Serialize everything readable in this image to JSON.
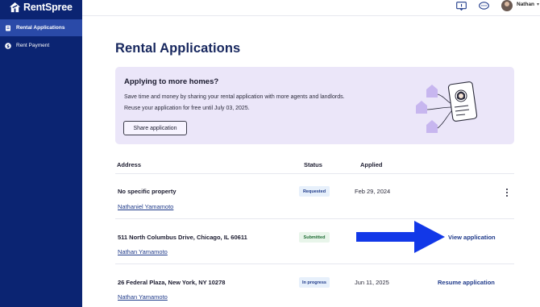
{
  "app": {
    "brand": "RentSpree",
    "brand_color": "#0b2472",
    "accent": "#1f3a8a"
  },
  "sidebar": {
    "items": [
      {
        "label": "Rental Applications",
        "icon": "document-icon",
        "active": true
      },
      {
        "label": "Rent Payment",
        "icon": "dollar-icon",
        "active": false
      }
    ]
  },
  "topbar": {
    "icons": [
      "help-chat-icon",
      "message-bubble-icon"
    ],
    "user_name": "Nathan"
  },
  "page": {
    "title": "Rental Applications"
  },
  "promo": {
    "title": "Applying to more homes?",
    "line1": "Save time and money by sharing your rental application with more agents and landlords.",
    "line2": "Reuse your application for free until July 03, 2025.",
    "button_label": "Share application",
    "illustration": "application-share-illustration"
  },
  "table": {
    "headers": {
      "address": "Address",
      "status": "Status",
      "applied": "Applied"
    },
    "rows": [
      {
        "address": "No specific property",
        "renter": "Nathaniel Yamamoto",
        "status": "Requested",
        "applied": "Feb 29, 2024",
        "action": ""
      },
      {
        "address": "511 North Columbus Drive, Chicago, IL 60611",
        "renter": "Nathan Yamamoto",
        "status": "Submitted",
        "applied": "",
        "action": "View application"
      },
      {
        "address": "26 Federal Plaza, New York, NY 10278",
        "renter": "Nathan Yamamoto",
        "status": "In progress",
        "applied": "Jun 11, 2025",
        "action": "Resume application"
      }
    ]
  },
  "annotation": {
    "arrow_color": "#1238e8",
    "arrow_icon": "right-arrow-icon"
  }
}
